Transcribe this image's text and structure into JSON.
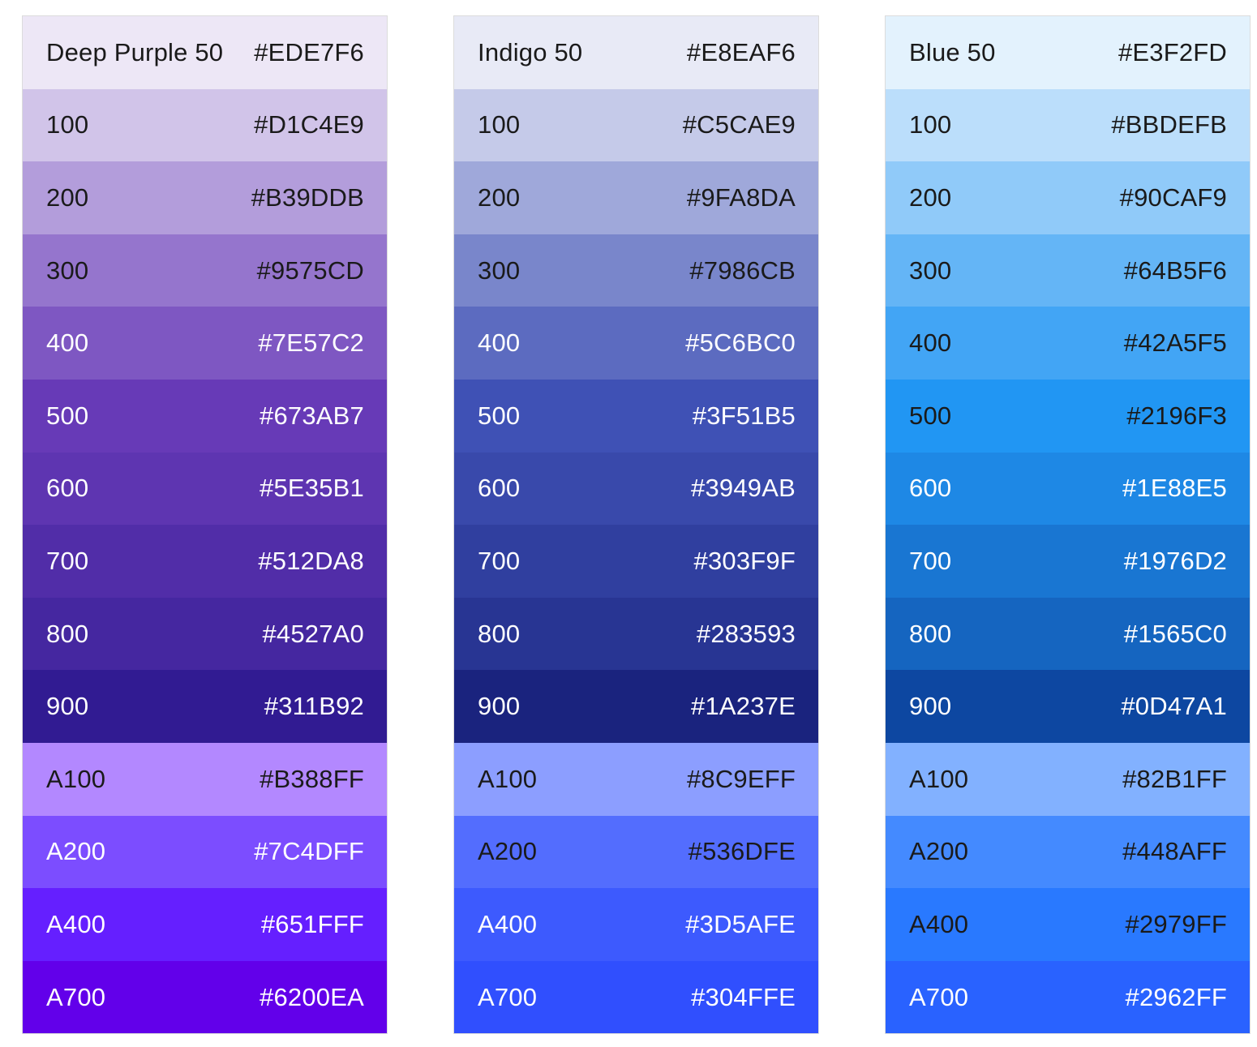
{
  "palettes": [
    {
      "name": "Deep Purple",
      "swatches": [
        {
          "label": "Deep Purple 50",
          "hex": "#EDE7F6",
          "color": "#EDE7F6",
          "text": "light"
        },
        {
          "label": "100",
          "hex": "#D1C4E9",
          "color": "#D1C4E9",
          "text": "light"
        },
        {
          "label": "200",
          "hex": "#B39DDB",
          "color": "#B39DDB",
          "text": "light"
        },
        {
          "label": "300",
          "hex": "#9575CD",
          "color": "#9575CD",
          "text": "light"
        },
        {
          "label": "400",
          "hex": "#7E57C2",
          "color": "#7E57C2",
          "text": "dark"
        },
        {
          "label": "500",
          "hex": "#673AB7",
          "color": "#673AB7",
          "text": "dark"
        },
        {
          "label": "600",
          "hex": "#5E35B1",
          "color": "#5E35B1",
          "text": "dark"
        },
        {
          "label": "700",
          "hex": "#512DA8",
          "color": "#512DA8",
          "text": "dark"
        },
        {
          "label": "800",
          "hex": "#4527A0",
          "color": "#4527A0",
          "text": "dark"
        },
        {
          "label": "900",
          "hex": "#311B92",
          "color": "#311B92",
          "text": "dark"
        },
        {
          "label": "A100",
          "hex": "#B388FF",
          "color": "#B388FF",
          "text": "light"
        },
        {
          "label": "A200",
          "hex": "#7C4DFF",
          "color": "#7C4DFF",
          "text": "dark"
        },
        {
          "label": "A400",
          "hex": "#651FFF",
          "color": "#651FFF",
          "text": "dark"
        },
        {
          "label": "A700",
          "hex": "#6200EA",
          "color": "#6200EA",
          "text": "dark"
        }
      ]
    },
    {
      "name": "Indigo",
      "swatches": [
        {
          "label": "Indigo 50",
          "hex": "#E8EAF6",
          "color": "#E8EAF6",
          "text": "light"
        },
        {
          "label": "100",
          "hex": "#C5CAE9",
          "color": "#C5CAE9",
          "text": "light"
        },
        {
          "label": "200",
          "hex": "#9FA8DA",
          "color": "#9FA8DA",
          "text": "light"
        },
        {
          "label": "300",
          "hex": "#7986CB",
          "color": "#7986CB",
          "text": "light"
        },
        {
          "label": "400",
          "hex": "#5C6BC0",
          "color": "#5C6BC0",
          "text": "dark"
        },
        {
          "label": "500",
          "hex": "#3F51B5",
          "color": "#3F51B5",
          "text": "dark"
        },
        {
          "label": "600",
          "hex": "#3949AB",
          "color": "#3949AB",
          "text": "dark"
        },
        {
          "label": "700",
          "hex": "#303F9F",
          "color": "#303F9F",
          "text": "dark"
        },
        {
          "label": "800",
          "hex": "#283593",
          "color": "#283593",
          "text": "dark"
        },
        {
          "label": "900",
          "hex": "#1A237E",
          "color": "#1A237E",
          "text": "dark"
        },
        {
          "label": "A100",
          "hex": "#8C9EFF",
          "color": "#8C9EFF",
          "text": "light"
        },
        {
          "label": "A200",
          "hex": "#536DFE",
          "color": "#536DFE",
          "text": "light"
        },
        {
          "label": "A400",
          "hex": "#3D5AFE",
          "color": "#3D5AFE",
          "text": "dark"
        },
        {
          "label": "A700",
          "hex": "#304FFE",
          "color": "#304FFE",
          "text": "dark"
        }
      ]
    },
    {
      "name": "Blue",
      "swatches": [
        {
          "label": "Blue 50",
          "hex": "#E3F2FD",
          "color": "#E3F2FD",
          "text": "light"
        },
        {
          "label": "100",
          "hex": "#BBDEFB",
          "color": "#BBDEFB",
          "text": "light"
        },
        {
          "label": "200",
          "hex": "#90CAF9",
          "color": "#90CAF9",
          "text": "light"
        },
        {
          "label": "300",
          "hex": "#64B5F6",
          "color": "#64B5F6",
          "text": "light"
        },
        {
          "label": "400",
          "hex": "#42A5F5",
          "color": "#42A5F5",
          "text": "light"
        },
        {
          "label": "500",
          "hex": "#2196F3",
          "color": "#2196F3",
          "text": "light"
        },
        {
          "label": "600",
          "hex": "#1E88E5",
          "color": "#1E88E5",
          "text": "dark"
        },
        {
          "label": "700",
          "hex": "#1976D2",
          "color": "#1976D2",
          "text": "dark"
        },
        {
          "label": "800",
          "hex": "#1565C0",
          "color": "#1565C0",
          "text": "dark"
        },
        {
          "label": "900",
          "hex": "#0D47A1",
          "color": "#0D47A1",
          "text": "dark"
        },
        {
          "label": "A100",
          "hex": "#82B1FF",
          "color": "#82B1FF",
          "text": "light"
        },
        {
          "label": "A200",
          "hex": "#448AFF",
          "color": "#448AFF",
          "text": "light"
        },
        {
          "label": "A400",
          "hex": "#2979FF",
          "color": "#2979FF",
          "text": "light"
        },
        {
          "label": "A700",
          "hex": "#2962FF",
          "color": "#2962FF",
          "text": "dark"
        }
      ]
    }
  ]
}
